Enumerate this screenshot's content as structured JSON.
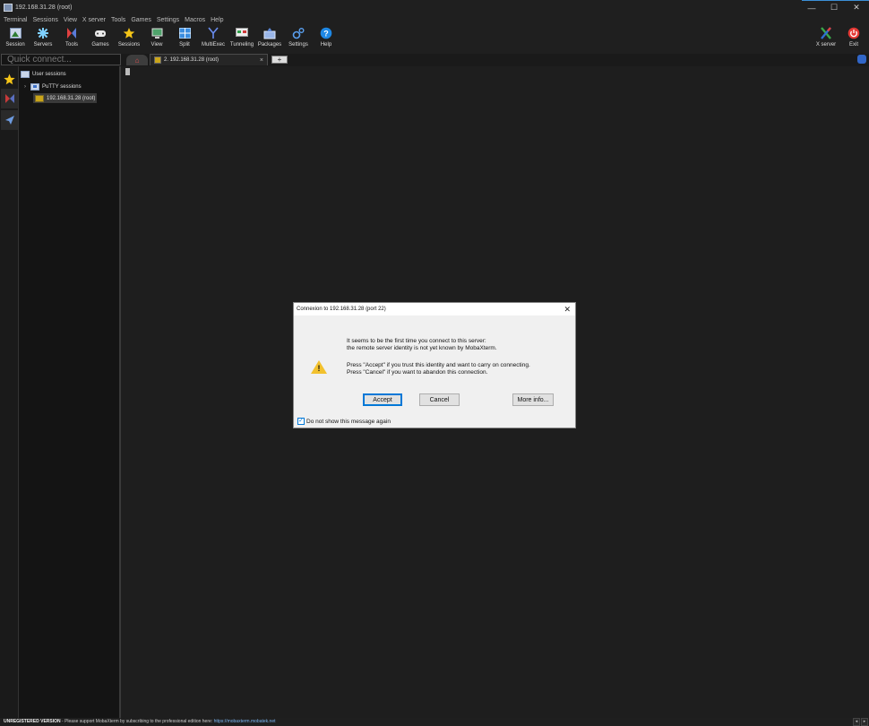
{
  "window": {
    "title": "192.168.31.28 (root)",
    "minimize_glyph": "—",
    "maximize_glyph": "☐",
    "close_glyph": "✕"
  },
  "menu": [
    "Terminal",
    "Sessions",
    "View",
    "X server",
    "Tools",
    "Games",
    "Settings",
    "Macros",
    "Help"
  ],
  "toolbar": {
    "items": [
      {
        "label": "Session",
        "icon": "session-icon"
      },
      {
        "label": "Servers",
        "icon": "servers-icon"
      },
      {
        "label": "Tools",
        "icon": "tools-icon"
      },
      {
        "label": "Games",
        "icon": "games-icon"
      },
      {
        "label": "Sessions",
        "icon": "sessions-star-icon"
      },
      {
        "label": "View",
        "icon": "view-icon"
      },
      {
        "label": "Split",
        "icon": "split-icon"
      },
      {
        "label": "MultiExec",
        "icon": "multiexec-icon"
      },
      {
        "label": "Tunneling",
        "icon": "tunneling-icon"
      },
      {
        "label": "Packages",
        "icon": "packages-icon"
      },
      {
        "label": "Settings",
        "icon": "settings-icon"
      },
      {
        "label": "Help",
        "icon": "help-icon"
      }
    ],
    "xserver_label": "X server",
    "exit_label": "Exit"
  },
  "quick_connect": {
    "placeholder": "Quick connect..."
  },
  "tabs": {
    "active_label": "2. 192.168.31.28 (root)",
    "close_glyph": "×",
    "add_glyph": "+"
  },
  "sidebar": {
    "root_label": "User sessions",
    "group_label": "PuTTY sessions",
    "expander_glyph": "›",
    "session_label": "192.168.31.28 (root)"
  },
  "dialog": {
    "title": "Connexion to 192.168.31.28 (port 22)",
    "close_glyph": "✕",
    "warning_glyph": "!",
    "line1": "It seems to be the first time you connect to this server:",
    "line2": "the remote server identity is not yet known by MobaXterm.",
    "line3": "Press \"Accept\" if you trust this identity and want to carry on connecting.",
    "line4": "Press \"Cancel\" if you want to abandon this connection.",
    "accept_label": "Accept",
    "cancel_label": "Cancel",
    "moreinfo_label": "More info...",
    "checkbox_label": "Do not show this message again",
    "checkbox_checked": true,
    "checkbox_glyph": "✓"
  },
  "statusbar": {
    "unregistered": "UNREGISTERED VERSION",
    "message": "  -  Please support MobaXterm by subscribing to the professional edition here: ",
    "link": "https://mobaxterm.mobatek.net"
  },
  "colors": {
    "accent": "#0078d7",
    "background": "#1e1e1e",
    "warning": "#f2c12e"
  }
}
